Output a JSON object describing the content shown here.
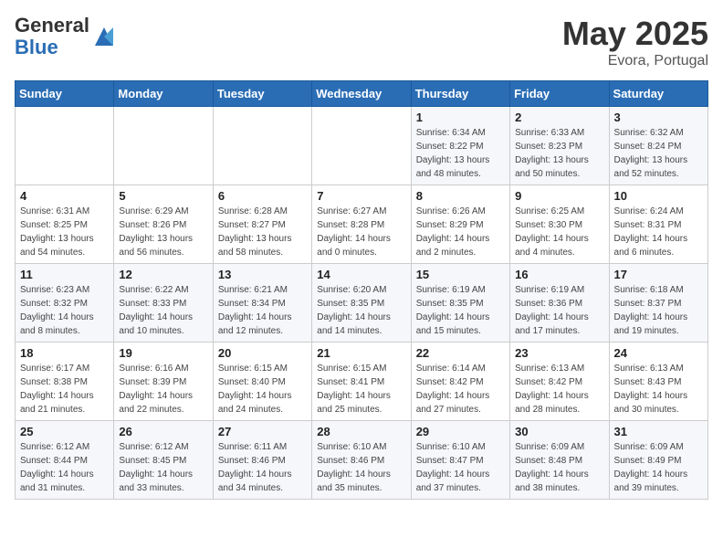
{
  "header": {
    "logo_general": "General",
    "logo_blue": "Blue",
    "month": "May 2025",
    "location": "Evora, Portugal"
  },
  "days_of_week": [
    "Sunday",
    "Monday",
    "Tuesday",
    "Wednesday",
    "Thursday",
    "Friday",
    "Saturday"
  ],
  "weeks": [
    [
      {
        "day": "",
        "sunrise": "",
        "sunset": "",
        "daylight": ""
      },
      {
        "day": "",
        "sunrise": "",
        "sunset": "",
        "daylight": ""
      },
      {
        "day": "",
        "sunrise": "",
        "sunset": "",
        "daylight": ""
      },
      {
        "day": "",
        "sunrise": "",
        "sunset": "",
        "daylight": ""
      },
      {
        "day": "1",
        "sunrise": "Sunrise: 6:34 AM",
        "sunset": "Sunset: 8:22 PM",
        "daylight": "Daylight: 13 hours and 48 minutes."
      },
      {
        "day": "2",
        "sunrise": "Sunrise: 6:33 AM",
        "sunset": "Sunset: 8:23 PM",
        "daylight": "Daylight: 13 hours and 50 minutes."
      },
      {
        "day": "3",
        "sunrise": "Sunrise: 6:32 AM",
        "sunset": "Sunset: 8:24 PM",
        "daylight": "Daylight: 13 hours and 52 minutes."
      }
    ],
    [
      {
        "day": "4",
        "sunrise": "Sunrise: 6:31 AM",
        "sunset": "Sunset: 8:25 PM",
        "daylight": "Daylight: 13 hours and 54 minutes."
      },
      {
        "day": "5",
        "sunrise": "Sunrise: 6:29 AM",
        "sunset": "Sunset: 8:26 PM",
        "daylight": "Daylight: 13 hours and 56 minutes."
      },
      {
        "day": "6",
        "sunrise": "Sunrise: 6:28 AM",
        "sunset": "Sunset: 8:27 PM",
        "daylight": "Daylight: 13 hours and 58 minutes."
      },
      {
        "day": "7",
        "sunrise": "Sunrise: 6:27 AM",
        "sunset": "Sunset: 8:28 PM",
        "daylight": "Daylight: 14 hours and 0 minutes."
      },
      {
        "day": "8",
        "sunrise": "Sunrise: 6:26 AM",
        "sunset": "Sunset: 8:29 PM",
        "daylight": "Daylight: 14 hours and 2 minutes."
      },
      {
        "day": "9",
        "sunrise": "Sunrise: 6:25 AM",
        "sunset": "Sunset: 8:30 PM",
        "daylight": "Daylight: 14 hours and 4 minutes."
      },
      {
        "day": "10",
        "sunrise": "Sunrise: 6:24 AM",
        "sunset": "Sunset: 8:31 PM",
        "daylight": "Daylight: 14 hours and 6 minutes."
      }
    ],
    [
      {
        "day": "11",
        "sunrise": "Sunrise: 6:23 AM",
        "sunset": "Sunset: 8:32 PM",
        "daylight": "Daylight: 14 hours and 8 minutes."
      },
      {
        "day": "12",
        "sunrise": "Sunrise: 6:22 AM",
        "sunset": "Sunset: 8:33 PM",
        "daylight": "Daylight: 14 hours and 10 minutes."
      },
      {
        "day": "13",
        "sunrise": "Sunrise: 6:21 AM",
        "sunset": "Sunset: 8:34 PM",
        "daylight": "Daylight: 14 hours and 12 minutes."
      },
      {
        "day": "14",
        "sunrise": "Sunrise: 6:20 AM",
        "sunset": "Sunset: 8:35 PM",
        "daylight": "Daylight: 14 hours and 14 minutes."
      },
      {
        "day": "15",
        "sunrise": "Sunrise: 6:19 AM",
        "sunset": "Sunset: 8:35 PM",
        "daylight": "Daylight: 14 hours and 15 minutes."
      },
      {
        "day": "16",
        "sunrise": "Sunrise: 6:19 AM",
        "sunset": "Sunset: 8:36 PM",
        "daylight": "Daylight: 14 hours and 17 minutes."
      },
      {
        "day": "17",
        "sunrise": "Sunrise: 6:18 AM",
        "sunset": "Sunset: 8:37 PM",
        "daylight": "Daylight: 14 hours and 19 minutes."
      }
    ],
    [
      {
        "day": "18",
        "sunrise": "Sunrise: 6:17 AM",
        "sunset": "Sunset: 8:38 PM",
        "daylight": "Daylight: 14 hours and 21 minutes."
      },
      {
        "day": "19",
        "sunrise": "Sunrise: 6:16 AM",
        "sunset": "Sunset: 8:39 PM",
        "daylight": "Daylight: 14 hours and 22 minutes."
      },
      {
        "day": "20",
        "sunrise": "Sunrise: 6:15 AM",
        "sunset": "Sunset: 8:40 PM",
        "daylight": "Daylight: 14 hours and 24 minutes."
      },
      {
        "day": "21",
        "sunrise": "Sunrise: 6:15 AM",
        "sunset": "Sunset: 8:41 PM",
        "daylight": "Daylight: 14 hours and 25 minutes."
      },
      {
        "day": "22",
        "sunrise": "Sunrise: 6:14 AM",
        "sunset": "Sunset: 8:42 PM",
        "daylight": "Daylight: 14 hours and 27 minutes."
      },
      {
        "day": "23",
        "sunrise": "Sunrise: 6:13 AM",
        "sunset": "Sunset: 8:42 PM",
        "daylight": "Daylight: 14 hours and 28 minutes."
      },
      {
        "day": "24",
        "sunrise": "Sunrise: 6:13 AM",
        "sunset": "Sunset: 8:43 PM",
        "daylight": "Daylight: 14 hours and 30 minutes."
      }
    ],
    [
      {
        "day": "25",
        "sunrise": "Sunrise: 6:12 AM",
        "sunset": "Sunset: 8:44 PM",
        "daylight": "Daylight: 14 hours and 31 minutes."
      },
      {
        "day": "26",
        "sunrise": "Sunrise: 6:12 AM",
        "sunset": "Sunset: 8:45 PM",
        "daylight": "Daylight: 14 hours and 33 minutes."
      },
      {
        "day": "27",
        "sunrise": "Sunrise: 6:11 AM",
        "sunset": "Sunset: 8:46 PM",
        "daylight": "Daylight: 14 hours and 34 minutes."
      },
      {
        "day": "28",
        "sunrise": "Sunrise: 6:10 AM",
        "sunset": "Sunset: 8:46 PM",
        "daylight": "Daylight: 14 hours and 35 minutes."
      },
      {
        "day": "29",
        "sunrise": "Sunrise: 6:10 AM",
        "sunset": "Sunset: 8:47 PM",
        "daylight": "Daylight: 14 hours and 37 minutes."
      },
      {
        "day": "30",
        "sunrise": "Sunrise: 6:09 AM",
        "sunset": "Sunset: 8:48 PM",
        "daylight": "Daylight: 14 hours and 38 minutes."
      },
      {
        "day": "31",
        "sunrise": "Sunrise: 6:09 AM",
        "sunset": "Sunset: 8:49 PM",
        "daylight": "Daylight: 14 hours and 39 minutes."
      }
    ]
  ]
}
